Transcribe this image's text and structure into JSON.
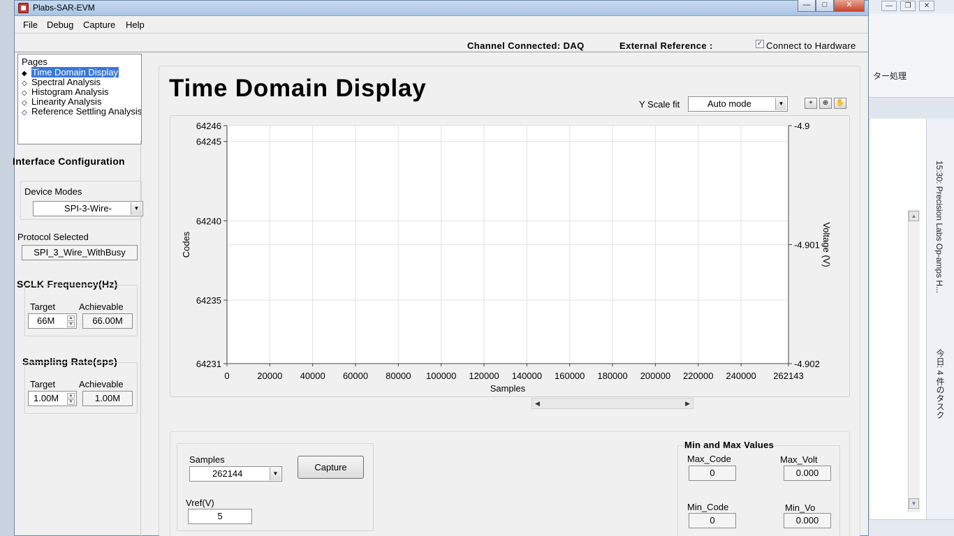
{
  "window": {
    "title": "Plabs-SAR-EVM"
  },
  "menu": [
    "File",
    "Debug",
    "Capture",
    "Help"
  ],
  "status": {
    "channel": "Channel Connected: DAQ",
    "external_ref": "External Reference :",
    "connect_label": "Connect to Hardware",
    "connect_checked": true
  },
  "pages": {
    "title": "Pages",
    "items": [
      "Time Domain Display",
      "Spectral Analysis",
      "Histogram Analysis",
      "Linearity Analysis",
      "Reference Settling Analysis"
    ],
    "selected": "Time Domain Display"
  },
  "interface": {
    "title": "Interface Configuration",
    "device_modes_label": "Device Modes",
    "device_mode": "SPI-3-Wire-",
    "protocol_label": "Protocol Selected",
    "protocol": "SPI_3_Wire_WithBusy"
  },
  "sclk": {
    "title": "SCLK Frequency(Hz)",
    "target_label": "Target",
    "achievable_label": "Achievable",
    "target": "66M",
    "achievable": "66.00M"
  },
  "sampling": {
    "title": "Sampling Rate(sps)",
    "target_label": "Target",
    "achievable_label": "Achievable",
    "target": "1.00M",
    "achievable": "1.00M"
  },
  "main": {
    "title": "Time Domain Display",
    "yscale_label": "Y Scale fit",
    "yscale_value": "Auto mode",
    "tools": [
      "cursor-tool-icon",
      "zoom-tool-icon",
      "pan-tool-icon"
    ]
  },
  "chart_data": {
    "type": "line",
    "xlabel": "Samples",
    "ylabel": "Codes",
    "y2label": "Voltage (V)",
    "x_ticks": [
      "0",
      "20000",
      "40000",
      "60000",
      "80000",
      "100000",
      "120000",
      "140000",
      "160000",
      "180000",
      "200000",
      "220000",
      "240000",
      "262143"
    ],
    "xlim": [
      0,
      262143
    ],
    "y_ticks": [
      "64246",
      "64245",
      "64240",
      "64235",
      "64231"
    ],
    "ylim": [
      64231,
      64246
    ],
    "y2_ticks": [
      "-4.902",
      "-4.901",
      "-4.9"
    ],
    "y2lim": [
      -4.902,
      -4.9
    ],
    "grid": true,
    "series": []
  },
  "capture": {
    "samples_label": "Samples",
    "samples_value": "262144",
    "capture_button": "Capture",
    "vref_label": "Vref(V)",
    "vref_value": "5"
  },
  "minmax": {
    "title": "Min and Max Values",
    "max_code_label": "Max_Code",
    "max_code": "0",
    "max_volt_label": "Max_Volt",
    "max_volt": "0.000",
    "min_code_label": "Min_Code",
    "min_code": "0",
    "min_volt_label": "Min_Vo",
    "min_volt": "0.000"
  },
  "background": {
    "ribbon_text": "ター処理",
    "todo_text": "15:30: Precision Labs Op-amps H...",
    "todo_text2": "今日: 4 件のタスク"
  }
}
